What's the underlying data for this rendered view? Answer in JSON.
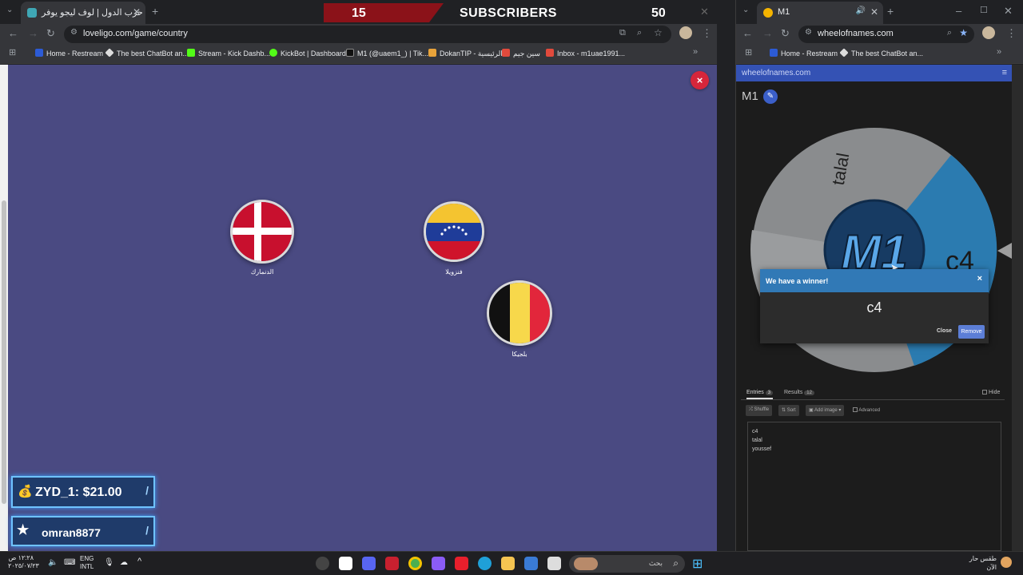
{
  "left": {
    "tab_title": "لعبة حرب الدول | لوف ليجو يوفر",
    "url": "loveligo.com/game/country",
    "bookmarks": [
      "Home - Restream",
      "The best ChatBot an...",
      "Stream - Kick Dashb...",
      "KickBot | Dashboard",
      "M1 (@uaem1_) | Tik...",
      "DokanTIP - الرئيسية",
      "سين جيم",
      "Inbox - m1uae1991..."
    ],
    "close_glyph": "×",
    "flags": [
      {
        "name": "الدنمارك",
        "country": "Denmark"
      },
      {
        "name": "فنزويلا",
        "country": "Venezuela"
      },
      {
        "name": "بلجيكا",
        "country": "Belgium"
      }
    ]
  },
  "subscribers": {
    "left_count": "15",
    "title": "SUBSCRIBERS",
    "right_count": "50"
  },
  "donations": [
    {
      "text": "ZYD_1: $21.00",
      "icon": "money-bag-icon"
    },
    {
      "text": "omran8877",
      "icon": "star-icon"
    }
  ],
  "right": {
    "tab_title": "M1",
    "url": "wheelofnames.com",
    "bookmarks": [
      "Home - Restream",
      "The best ChatBot an..."
    ],
    "site_header": "wheelofnames.com",
    "wheel_title": "M1",
    "wheel_labels": [
      "talal",
      "c4"
    ],
    "center_logo": "M1",
    "popup": {
      "title": "We have a winner!",
      "winner": "c4",
      "close_label": "Close",
      "remove_label": "Remove",
      "x": "×"
    },
    "tabs": {
      "entries_label": "Entries",
      "entries_count": "3",
      "results_label": "Results",
      "results_count": "12",
      "hide_label": "Hide"
    },
    "toolbar": {
      "shuffle": "Shuffle",
      "sort": "Sort",
      "add_image": "Add image",
      "advanced": "Advanced"
    },
    "entries": [
      "c4",
      "talal",
      "youssef"
    ]
  },
  "taskbar": {
    "time": "١٢:٢٨ ص",
    "date": "٢٠٢٥/٠٧/٢٣",
    "lang1": "ENG",
    "lang2": "INTL",
    "search_placeholder": "بحث",
    "weather": "طقس حار",
    "weather_sub": "الآن"
  },
  "colors": {
    "game_bg": "#4a4a82",
    "wheel_blue": "#2b7bb0",
    "wheel_gray": "#8a8c8e",
    "popup_blue": "#3179b6"
  }
}
